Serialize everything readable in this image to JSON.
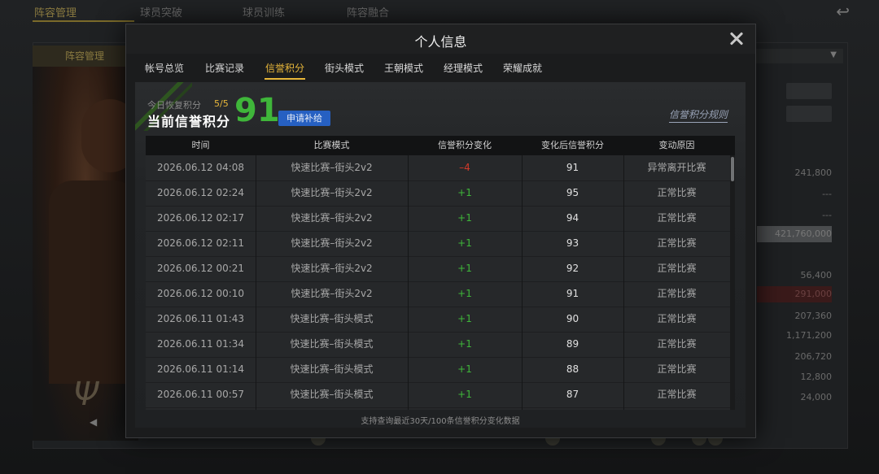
{
  "background": {
    "top_tabs": [
      {
        "label": "阵容管理"
      },
      {
        "label": "球员突破"
      },
      {
        "label": "球员训练"
      },
      {
        "label": "阵容融合"
      }
    ],
    "sub_tab": "阵容管理",
    "signature": "Ψ",
    "right_values": [
      "241,800",
      "---",
      "---",
      "421,760,000",
      "56,400",
      "291,000",
      "207,360",
      "1,171,200",
      "206,720",
      "12,800",
      "24,000"
    ]
  },
  "modal": {
    "title": "个人信息",
    "tabs": [
      {
        "label": "帐号总览"
      },
      {
        "label": "比赛记录"
      },
      {
        "label": "信誉积分"
      },
      {
        "label": "街头模式"
      },
      {
        "label": "王朝模式"
      },
      {
        "label": "经理模式"
      },
      {
        "label": "荣耀成就"
      }
    ],
    "active_tab": "信誉积分",
    "summary": {
      "recovery_label": "今日恢复积分",
      "recovery_count": "5/5",
      "score_label": "当前信誉积分",
      "score_value": "91",
      "apply_button": "申请补给",
      "rules_link": "信誉积分规则"
    },
    "table": {
      "headers": [
        "时间",
        "比赛模式",
        "信誉积分变化",
        "变化后信誉积分",
        "变动原因"
      ],
      "rows": [
        {
          "time": "2026.06.12  04:08",
          "mode": "快速比赛–街头2v2",
          "delta": "–4",
          "after": "91",
          "reason": "异常离开比赛"
        },
        {
          "time": "2026.06.12  02:24",
          "mode": "快速比赛–街头2v2",
          "delta": "+1",
          "after": "95",
          "reason": "正常比赛"
        },
        {
          "time": "2026.06.12  02:17",
          "mode": "快速比赛–街头2v2",
          "delta": "+1",
          "after": "94",
          "reason": "正常比赛"
        },
        {
          "time": "2026.06.12  02:11",
          "mode": "快速比赛–街头2v2",
          "delta": "+1",
          "after": "93",
          "reason": "正常比赛"
        },
        {
          "time": "2026.06.12  00:21",
          "mode": "快速比赛–街头2v2",
          "delta": "+1",
          "after": "92",
          "reason": "正常比赛"
        },
        {
          "time": "2026.06.12  00:10",
          "mode": "快速比赛–街头2v2",
          "delta": "+1",
          "after": "91",
          "reason": "正常比赛"
        },
        {
          "time": "2026.06.11  01:43",
          "mode": "快速比赛–街头模式",
          "delta": "+1",
          "after": "90",
          "reason": "正常比赛"
        },
        {
          "time": "2026.06.11  01:34",
          "mode": "快速比赛–街头模式",
          "delta": "+1",
          "after": "89",
          "reason": "正常比赛"
        },
        {
          "time": "2026.06.11  01:14",
          "mode": "快速比赛–街头模式",
          "delta": "+1",
          "after": "88",
          "reason": "正常比赛"
        },
        {
          "time": "2026.06.11  00:57",
          "mode": "快速比赛–街头模式",
          "delta": "+1",
          "after": "87",
          "reason": "正常比赛"
        }
      ]
    },
    "footer_note": "支持查询最近30天/100条信誉积分变化数据"
  },
  "colors": {
    "accent": "#e8b73a",
    "score_green": "#3fb63a",
    "negative_red": "#d23a2a",
    "button_blue": "#2660c2"
  }
}
